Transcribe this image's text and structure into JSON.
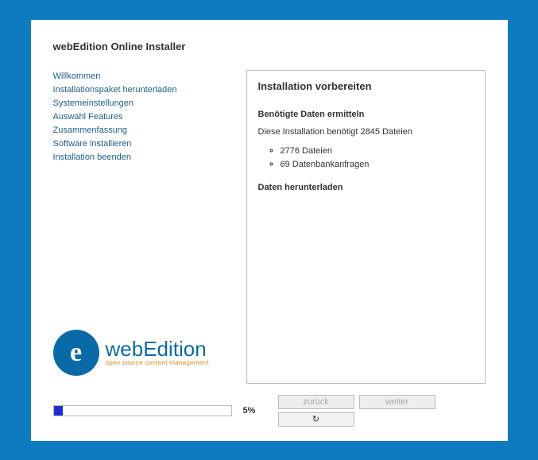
{
  "title": "webEdition Online Installer",
  "sidebar": {
    "items": [
      {
        "label": "Willkommen"
      },
      {
        "label": "Installationspaket herunterladen"
      },
      {
        "label": "Systemeinstellungen"
      },
      {
        "label": "Auswahl Features"
      },
      {
        "label": "Zusammenfassung"
      },
      {
        "label": "Software installieren"
      },
      {
        "label": "Installation beenden"
      }
    ]
  },
  "logo": {
    "letter": "e",
    "brand_light": "web",
    "brand_bold": "Edition",
    "tagline": "open source content management"
  },
  "content": {
    "heading": "Installation vorbereiten",
    "sub1": "Benötigte Daten ermitteln",
    "text1": "Diese Installation benötigt 2845 Dateien",
    "items": [
      "2776 Dateien",
      "69 Datenbankanfragen"
    ],
    "sub2": "Daten herunterladen"
  },
  "progress": {
    "percent": 5,
    "label": "5%"
  },
  "buttons": {
    "back": "zurück",
    "next": "weiter",
    "reload": "↻"
  }
}
